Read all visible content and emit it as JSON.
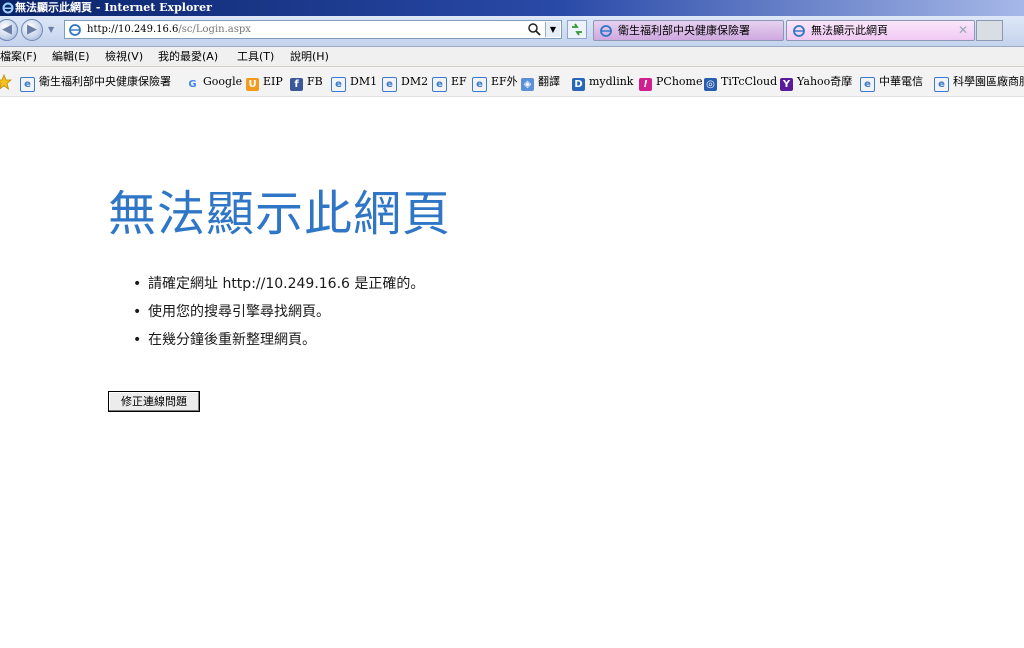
{
  "window": {
    "title": "無法顯示此網頁 - Internet Explorer"
  },
  "address_bar": {
    "host": "http://10.249.16.6",
    "path": "/sc/Login.aspx"
  },
  "tabs": [
    {
      "label": "衛生福利部中央健康保險署",
      "active": false
    },
    {
      "label": "無法顯示此網頁",
      "active": true
    }
  ],
  "menu": {
    "items": [
      "檔案(F)",
      "編輯(E)",
      "檢視(V)",
      "我的最愛(A)",
      "工具(T)",
      "說明(H)"
    ]
  },
  "favorites": {
    "items": [
      {
        "label": "衛生福利部中央健康保險署",
        "icon": "ie-page-icon"
      },
      {
        "label": "Google",
        "icon": "google-icon"
      },
      {
        "label": "EIP",
        "icon": "eip-icon"
      },
      {
        "label": "FB",
        "icon": "facebook-icon"
      },
      {
        "label": "DM1",
        "icon": "ie-page-icon"
      },
      {
        "label": "DM2",
        "icon": "ie-page-icon"
      },
      {
        "label": "EF",
        "icon": "ie-page-icon"
      },
      {
        "label": "EF外",
        "icon": "ie-page-icon"
      },
      {
        "label": "翻譯",
        "icon": "translate-icon"
      },
      {
        "label": "mydlink",
        "icon": "dlink-icon"
      },
      {
        "label": "PChome",
        "icon": "pchome-icon"
      },
      {
        "label": "TiTcCloud",
        "icon": "cloud-icon"
      },
      {
        "label": "Yahoo奇摩",
        "icon": "yahoo-icon"
      },
      {
        "label": "中華電信",
        "icon": "ie-page-icon"
      },
      {
        "label": "科學園區廠商服",
        "icon": "ie-page-icon"
      }
    ]
  },
  "content": {
    "heading": "無法顯示此網頁",
    "tips": [
      "請確定網址 http://10.249.16.6 是正確的。",
      "使用您的搜尋引擎尋找網頁。",
      "在幾分鐘後重新整理網頁。"
    ],
    "fix_button_label": "修正連線問題"
  },
  "colors": {
    "heading": "#2f77c6",
    "titlebar": "#0a246a"
  }
}
